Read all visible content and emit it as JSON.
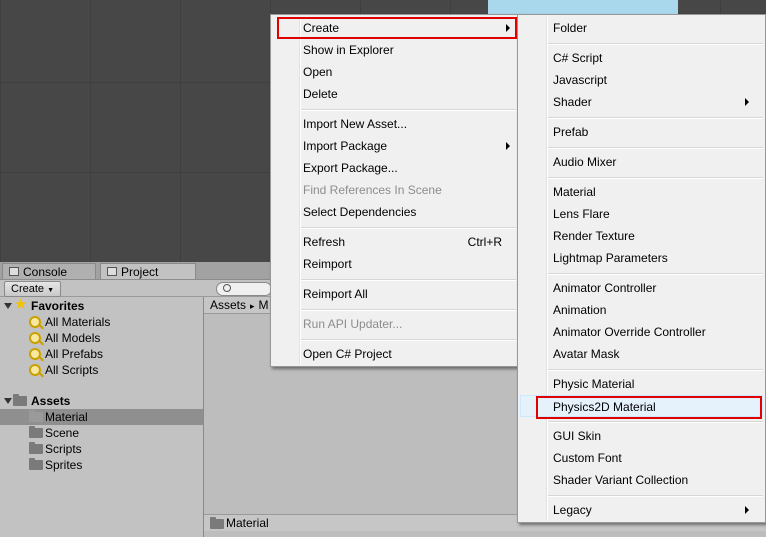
{
  "bottom_panel": {
    "tabs": [
      {
        "label": "Console"
      },
      {
        "label": "Project"
      }
    ],
    "create_label": "Create",
    "favorites": {
      "label": "Favorites",
      "items": [
        "All Materials",
        "All Models",
        "All Prefabs",
        "All Scripts"
      ]
    },
    "assets": {
      "label": "Assets",
      "items": [
        "Material",
        "Scene",
        "Scripts",
        "Sprites"
      ],
      "selected": "Material"
    },
    "breadcrumb": {
      "root": "Assets",
      "sep": "▸",
      "next": "M"
    },
    "status_path": "Material"
  },
  "context_menu": {
    "items": [
      {
        "label": "Create",
        "submenu": true
      },
      {
        "label": "Show in Explorer"
      },
      {
        "label": "Open"
      },
      {
        "label": "Delete"
      },
      {
        "label": "Import New Asset..."
      },
      {
        "label": "Import Package",
        "submenu": true
      },
      {
        "label": "Export Package..."
      },
      {
        "label": "Find References In Scene",
        "disabled": true
      },
      {
        "label": "Select Dependencies"
      },
      {
        "label": "Refresh",
        "shortcut": "Ctrl+R"
      },
      {
        "label": "Reimport"
      },
      {
        "label": "Reimport All"
      },
      {
        "label": "Run API Updater...",
        "disabled": true
      },
      {
        "label": "Open C# Project"
      }
    ]
  },
  "create_submenu": {
    "items": [
      {
        "label": "Folder"
      },
      {
        "label": "C# Script"
      },
      {
        "label": "Javascript"
      },
      {
        "label": "Shader",
        "submenu": true
      },
      {
        "label": "Prefab"
      },
      {
        "label": "Audio Mixer"
      },
      {
        "label": "Material"
      },
      {
        "label": "Lens Flare"
      },
      {
        "label": "Render Texture"
      },
      {
        "label": "Lightmap Parameters"
      },
      {
        "label": "Animator Controller"
      },
      {
        "label": "Animation"
      },
      {
        "label": "Animator Override Controller"
      },
      {
        "label": "Avatar Mask"
      },
      {
        "label": "Physic Material"
      },
      {
        "label": "Physics2D Material",
        "hover": true
      },
      {
        "label": "GUI Skin"
      },
      {
        "label": "Custom Font"
      },
      {
        "label": "Shader Variant Collection"
      },
      {
        "label": "Legacy",
        "submenu": true
      }
    ]
  },
  "colors": {
    "highlight_box": "#e00000",
    "hover": "#e5f1fb",
    "menu_bg": "#f0f0f0"
  }
}
